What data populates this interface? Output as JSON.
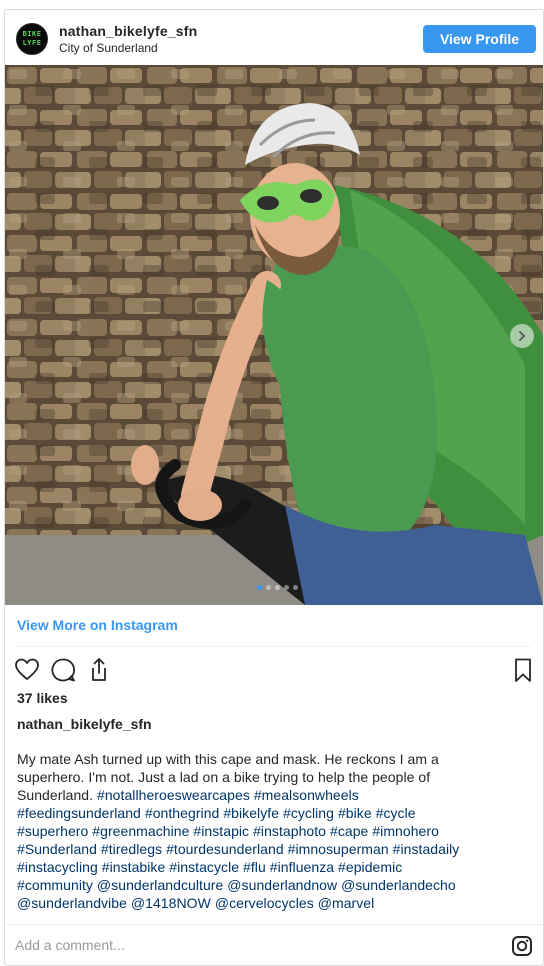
{
  "header": {
    "username": "nathan_bikelyfe_sfn",
    "location": "City of Sunderland",
    "avatar_text": "BIKE LYFE",
    "view_profile_label": "View Profile"
  },
  "photo": {
    "carousel_count": 5,
    "carousel_active_index": 0,
    "next_icon": "chevron-right-icon"
  },
  "view_more_label": "View More on Instagram",
  "actions": {
    "like_icon": "heart-icon",
    "comment_icon": "comment-icon",
    "share_icon": "share-icon",
    "save_icon": "bookmark-icon"
  },
  "likes_text": "37 likes",
  "caption": {
    "username": "nathan_bikelyfe_sfn",
    "lines": [
      [
        {
          "t": "My mate Ash turned up with this cape and mask. He reckons I am a",
          "tag": false
        }
      ],
      [
        {
          "t": "superhero. I'm not. Just a lad on a bike trying to help the people of",
          "tag": false
        }
      ],
      [
        {
          "t": "Sunderland. ",
          "tag": false
        },
        {
          "t": "#notallheroeswearcapes",
          "tag": true
        },
        {
          "t": " ",
          "tag": false
        },
        {
          "t": "#mealsonwheels",
          "tag": true
        }
      ],
      [
        {
          "t": "#feedingsunderland",
          "tag": true
        },
        {
          "t": " ",
          "tag": false
        },
        {
          "t": "#onthegrind",
          "tag": true
        },
        {
          "t": " ",
          "tag": false
        },
        {
          "t": "#bikelyfe",
          "tag": true
        },
        {
          "t": " ",
          "tag": false
        },
        {
          "t": "#cycling",
          "tag": true
        },
        {
          "t": " ",
          "tag": false
        },
        {
          "t": "#bike",
          "tag": true
        },
        {
          "t": " ",
          "tag": false
        },
        {
          "t": "#cycle",
          "tag": true
        }
      ],
      [
        {
          "t": "#superhero",
          "tag": true
        },
        {
          "t": " ",
          "tag": false
        },
        {
          "t": "#greenmachine",
          "tag": true
        },
        {
          "t": " ",
          "tag": false
        },
        {
          "t": "#instapic",
          "tag": true
        },
        {
          "t": " ",
          "tag": false
        },
        {
          "t": "#instaphoto",
          "tag": true
        },
        {
          "t": " ",
          "tag": false
        },
        {
          "t": "#cape",
          "tag": true
        },
        {
          "t": " ",
          "tag": false
        },
        {
          "t": "#imnohero",
          "tag": true
        }
      ],
      [
        {
          "t": "#Sunderland",
          "tag": true
        },
        {
          "t": " ",
          "tag": false
        },
        {
          "t": "#tiredlegs",
          "tag": true
        },
        {
          "t": " ",
          "tag": false
        },
        {
          "t": "#tourdesunderland",
          "tag": true
        },
        {
          "t": " ",
          "tag": false
        },
        {
          "t": "#imnosuperman",
          "tag": true
        },
        {
          "t": " ",
          "tag": false
        },
        {
          "t": "#instadaily",
          "tag": true
        }
      ],
      [
        {
          "t": "#instacycling",
          "tag": true
        },
        {
          "t": " ",
          "tag": false
        },
        {
          "t": "#instabike",
          "tag": true
        },
        {
          "t": " ",
          "tag": false
        },
        {
          "t": "#instacycle",
          "tag": true
        },
        {
          "t": " ",
          "tag": false
        },
        {
          "t": "#flu",
          "tag": true
        },
        {
          "t": " ",
          "tag": false
        },
        {
          "t": "#influenza",
          "tag": true
        },
        {
          "t": " ",
          "tag": false
        },
        {
          "t": "#epidemic",
          "tag": true
        }
      ],
      [
        {
          "t": "#community",
          "tag": true
        },
        {
          "t": " ",
          "tag": false
        },
        {
          "t": "@sunderlandculture",
          "tag": true
        },
        {
          "t": " ",
          "tag": false
        },
        {
          "t": "@sunderlandnow",
          "tag": true
        },
        {
          "t": " ",
          "tag": false
        },
        {
          "t": "@sunderlandecho",
          "tag": true
        }
      ],
      [
        {
          "t": "@sunderlandvibe",
          "tag": true
        },
        {
          "t": " ",
          "tag": false
        },
        {
          "t": "@1418NOW",
          "tag": true
        },
        {
          "t": " ",
          "tag": false
        },
        {
          "t": "@cervelocycles",
          "tag": true
        },
        {
          "t": " ",
          "tag": false
        },
        {
          "t": "@marvel",
          "tag": true
        }
      ]
    ]
  },
  "comment": {
    "placeholder": "Add a comment...",
    "icon": "instagram-icon"
  },
  "colors": {
    "accent": "#3897f0",
    "hashtag": "#003569",
    "text": "#262626",
    "muted": "#999999",
    "border": "#dbdbdb"
  }
}
